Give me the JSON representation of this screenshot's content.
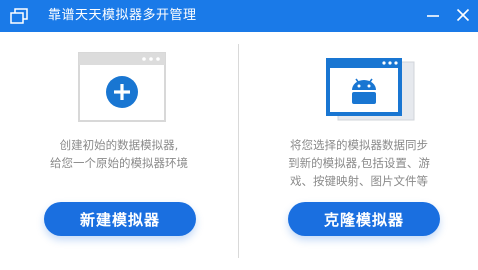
{
  "window": {
    "title": "靠谱天天模拟器多开管理"
  },
  "titlebar": {
    "icons": [
      "window-stack-icon",
      "minimize-icon",
      "close-icon"
    ]
  },
  "left_panel": {
    "icon": "add-emulator-window-icon",
    "description_line1": "创建初始的数据模拟器,",
    "description_line2": "给您一个原始的模拟器环境",
    "button_label": "新建模拟器"
  },
  "right_panel": {
    "icon": "android-clone-window-icon",
    "description_line1": "将您选择的模拟器数据同步",
    "description_line2": "到新的模拟器,包括设置、游",
    "description_line3": "戏、按键映射、图片文件等",
    "button_label": "克隆模拟器"
  },
  "colors": {
    "titlebar": "#1a7ae8",
    "primary_button": "#1a6fe0",
    "description_text": "#8a8a8a",
    "illustration_gray": "#dcdcdc",
    "illustration_blue": "#1976d2"
  }
}
